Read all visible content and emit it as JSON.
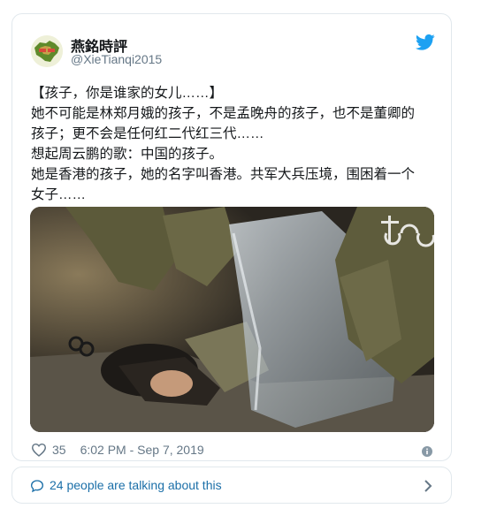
{
  "tweet": {
    "author": {
      "display_name": "燕銘時評",
      "handle": "@XieTianqi2015"
    },
    "text_lines": [
      "【孩子，你是谁家的女儿……】",
      "她不可能是林郑月娥的孩子，不是孟晚舟的孩子，也不是董卿的",
      "孩子；更不会是任何红二代红三代……",
      "想起周云鹏的歌：中国的孩子。",
      "她是香港的孩子，她的名字叫香港。共军大兵压境，围困着一个",
      "女子……"
    ],
    "likes": "35",
    "timestamp": "6:02 PM - Sep 7, 2019",
    "icons": [
      "twitter-bird-icon",
      "heart-icon",
      "info-icon",
      "speech-bubble-icon",
      "chevron-right-icon"
    ],
    "colors": {
      "twitter_blue": "#1da1f2",
      "link_blue": "#1b6fa8",
      "muted": "#657786",
      "border": "#e1e8ed"
    }
  },
  "conversation": {
    "label": "24 people are talking about this"
  }
}
